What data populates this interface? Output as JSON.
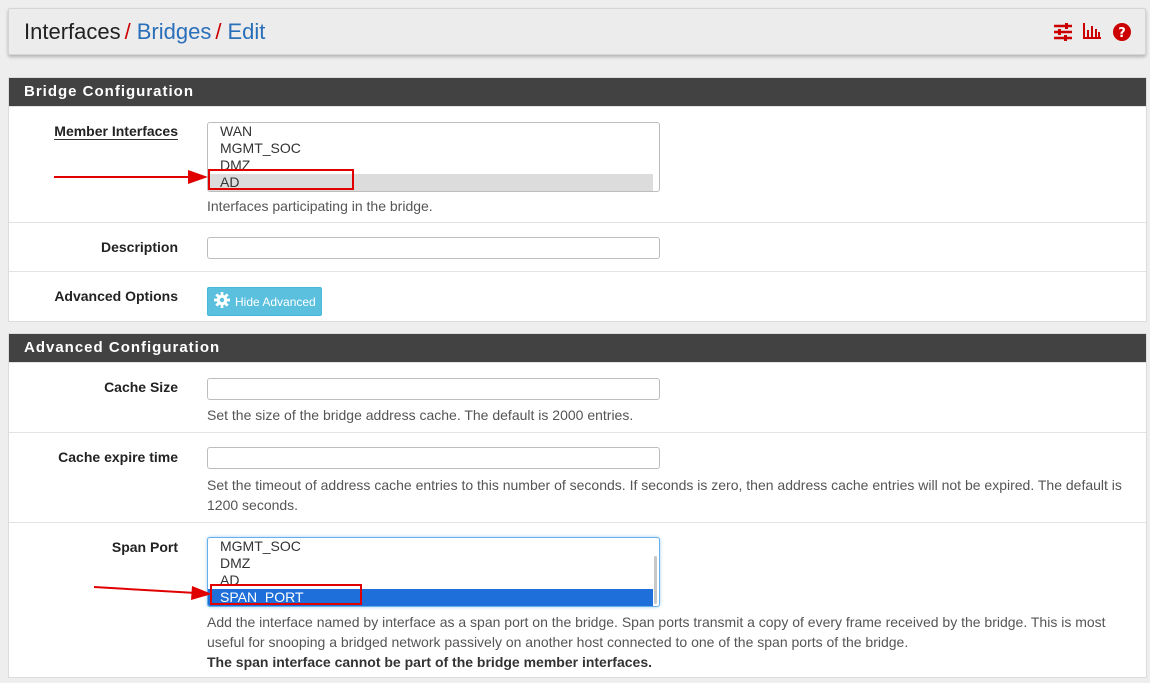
{
  "breadcrumb": {
    "root": "Interfaces",
    "bridges": "Bridges",
    "edit": "Edit",
    "sep": "/"
  },
  "header_icons": [
    "sliders-icon",
    "bar-chart-icon",
    "help-icon"
  ],
  "colors": {
    "accent_red": "#cc0000",
    "link_blue": "#2a6fba",
    "panel_head": "#424242",
    "button_info": "#5bc0de",
    "selected_blue": "#1e6fd9",
    "annotation_red": "#e00000"
  },
  "bridge_config": {
    "title": "Bridge Configuration",
    "member_interfaces": {
      "label": "Member Interfaces",
      "options": [
        "WAN",
        "MGMT_SOC",
        "DMZ",
        "AD"
      ],
      "selected": "AD",
      "help": "Interfaces participating in the bridge."
    },
    "description": {
      "label": "Description",
      "value": ""
    },
    "advanced_options": {
      "label": "Advanced Options",
      "button": "Hide Advanced"
    }
  },
  "advanced_config": {
    "title": "Advanced Configuration",
    "cache_size": {
      "label": "Cache Size",
      "value": "",
      "help": "Set the size of the bridge address cache. The default is 2000 entries."
    },
    "cache_expire": {
      "label": "Cache expire time",
      "value": "",
      "help": "Set the timeout of address cache entries to this number of seconds. If seconds is zero, then address cache entries will not be expired. The default is 1200 seconds."
    },
    "span_port": {
      "label": "Span Port",
      "options": [
        "MGMT_SOC",
        "DMZ",
        "AD",
        "SPAN_PORT"
      ],
      "selected": "SPAN_PORT",
      "help": "Add the interface named by interface as a span port on the bridge. Span ports transmit a copy of every frame received by the bridge. This is most useful for snooping a bridged network passively on another host connected to one of the span ports of the bridge.",
      "help_bold": "The span interface cannot be part of the bridge member interfaces."
    }
  }
}
